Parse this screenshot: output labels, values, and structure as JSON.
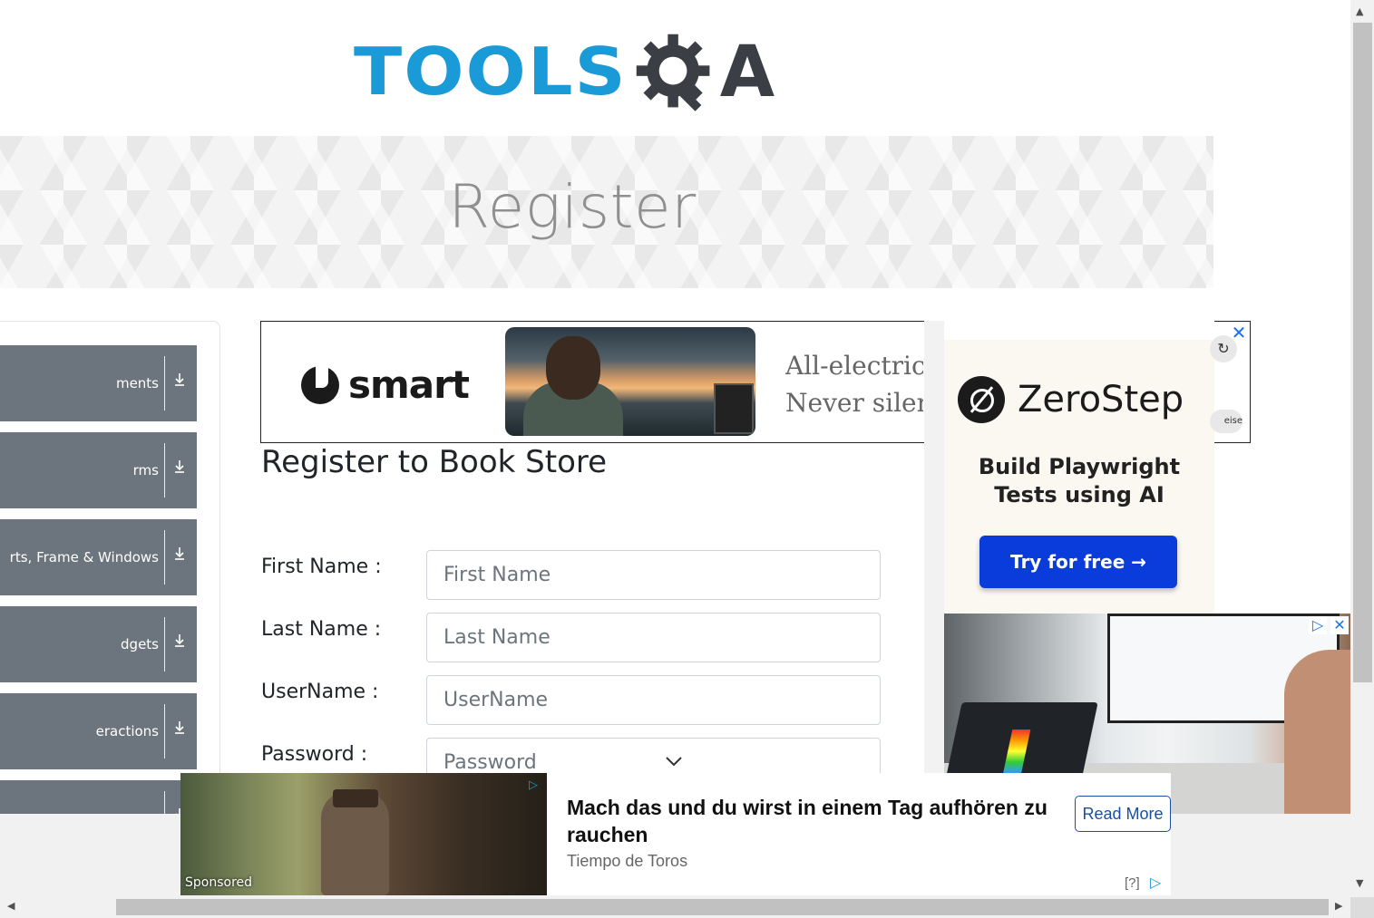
{
  "header": {
    "logo_text_primary": "TOOLS",
    "logo_text_secondary": "A",
    "logo_icon": "gear-q-icon"
  },
  "banner": {
    "title": "Register"
  },
  "sidebar": {
    "items": [
      {
        "label": "ments",
        "icon": "download-icon"
      },
      {
        "label": "rms",
        "icon": "download-icon"
      },
      {
        "label": "rts, Frame & Windows",
        "icon": "download-icon"
      },
      {
        "label": "dgets",
        "icon": "download-icon"
      },
      {
        "label": "eractions",
        "icon": "download-icon"
      },
      {
        "label": "",
        "icon": "download-icon"
      }
    ]
  },
  "ad_top": {
    "brand": "smart",
    "copy_line1": "All-electric",
    "copy_line2": "Never silen",
    "close": "✕",
    "refresh": "↻",
    "pill": "eise"
  },
  "form": {
    "title": "Register to Book Store",
    "fields": [
      {
        "label": "First Name :",
        "placeholder": "First Name",
        "value": ""
      },
      {
        "label": "Last Name :",
        "placeholder": "Last Name",
        "value": ""
      },
      {
        "label": "UserName :",
        "placeholder": "UserName",
        "value": ""
      },
      {
        "label": "Password :",
        "placeholder": "Password",
        "value": ""
      }
    ]
  },
  "ad_right": {
    "brand": "ZeroStep",
    "tagline_1": "Build Playwright",
    "tagline_2": "Tests using AI",
    "cta": "Try for free →"
  },
  "ad_right_lower": {
    "icons": [
      "▷",
      "✕"
    ]
  },
  "sponsored": {
    "label": "Sponsored",
    "title": "Mach das und du wirst in einem Tag aufhören zu rauchen",
    "source": "Tiempo de Toros",
    "button": "Read More",
    "help": "[?]",
    "adchoices": "▷"
  },
  "colors": {
    "accent": "#1a9ad6",
    "sidebar": "#6c757d",
    "cta": "#0a3bdb"
  }
}
